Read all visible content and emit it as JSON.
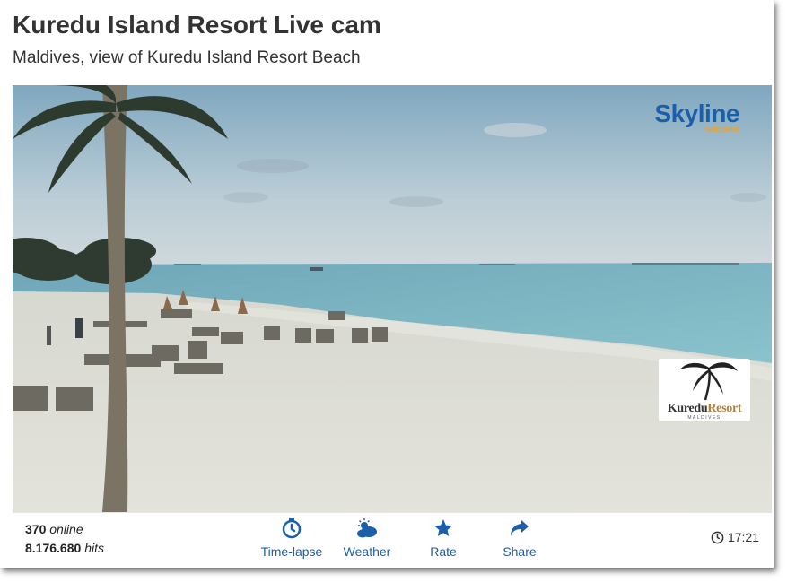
{
  "header": {
    "title": "Kuredu Island Resort Live cam",
    "subtitle": "Maldives, view of Kuredu Island Resort Beach"
  },
  "video": {
    "watermark_brand": "Skyline",
    "watermark_sub": "webcams",
    "resort_logo_name": "Kuredu",
    "resort_logo_name2": "Resort",
    "resort_logo_place": "MALDIVES"
  },
  "footer": {
    "online_count": "370",
    "online_label": "online",
    "hits_count": "8.176.680",
    "hits_label": "hits",
    "actions": [
      {
        "label": "Time-lapse",
        "icon": "timelapse-icon"
      },
      {
        "label": "Weather",
        "icon": "weather-icon"
      },
      {
        "label": "Rate",
        "icon": "star-icon"
      },
      {
        "label": "Share",
        "icon": "share-icon"
      }
    ],
    "time": "17:21"
  },
  "colors": {
    "accent": "#1a5fa8",
    "skyline_orange": "#f0a020",
    "title_text": "#333333"
  }
}
